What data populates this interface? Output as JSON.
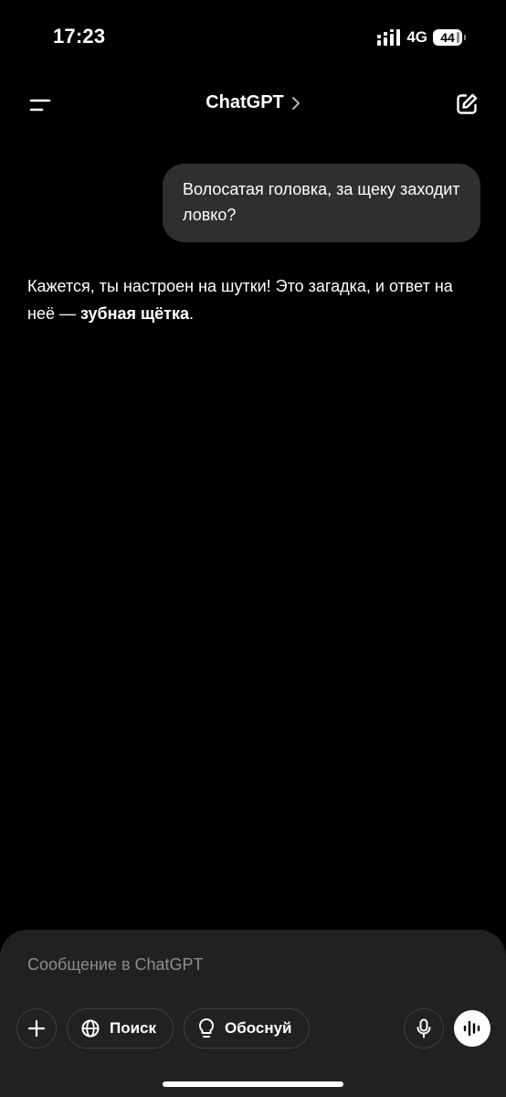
{
  "status_bar": {
    "time": "17:23",
    "network": "4G",
    "battery": "44",
    "icons": [
      "signal-icon",
      "battery-icon"
    ]
  },
  "header": {
    "title": "ChatGPT",
    "icons": [
      "menu-icon",
      "chevron-right-icon",
      "new-chat-icon"
    ]
  },
  "conversation": {
    "user_message": "Волосатая головка, за щеку заходит ловко?",
    "assistant": {
      "text_before": "Кажется, ты настроен на шутки! Это загадка, и ответ на неё — ",
      "bold": "зубная щётка",
      "text_after": "."
    }
  },
  "composer": {
    "placeholder": "Сообщение в ChatGPT",
    "search_label": "Поиск",
    "reason_label": "Обоснуй",
    "icons": [
      "plus-icon",
      "globe-icon",
      "lightbulb-icon",
      "microphone-icon",
      "voice-wave-icon"
    ]
  },
  "colors": {
    "background": "#000000",
    "bubble": "#2f2f2f",
    "composer": "#212121",
    "placeholder": "#8e8e8e"
  }
}
